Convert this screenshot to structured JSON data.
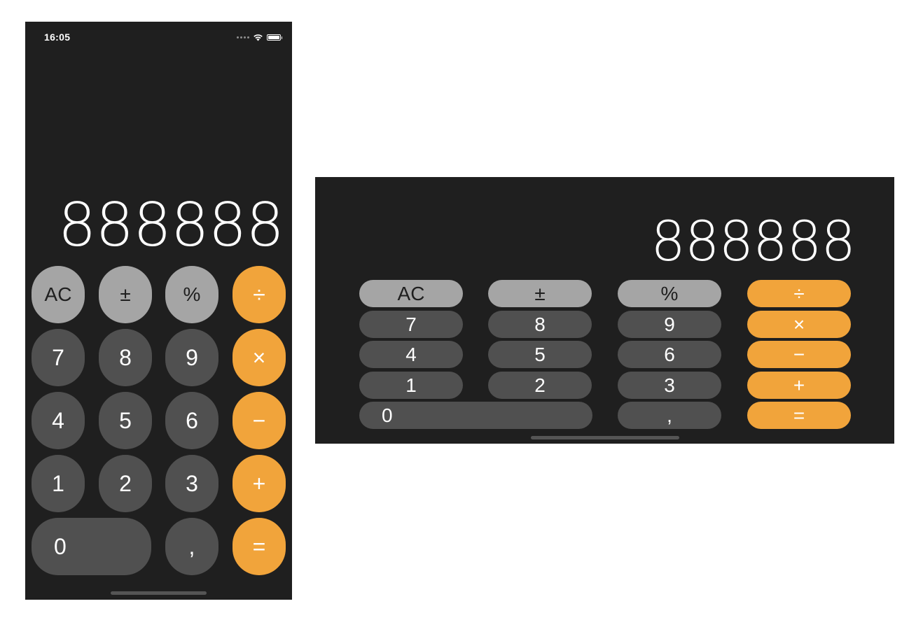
{
  "status_bar": {
    "time": "16:05"
  },
  "display": {
    "value": "888888"
  },
  "keys": {
    "clear": "AC",
    "sign": "±",
    "percent": "%",
    "divide": "÷",
    "multiply": "×",
    "minus": "−",
    "plus": "+",
    "equals": "=",
    "decimal": ",",
    "d0": "0",
    "d1": "1",
    "d2": "2",
    "d3": "3",
    "d4": "4",
    "d5": "5",
    "d6": "6",
    "d7": "7",
    "d8": "8",
    "d9": "9"
  },
  "colors": {
    "background": "#1f1f1f",
    "digit_key": "#505050",
    "function_key": "#a5a5a5",
    "operator_key": "#f1a43b",
    "page": "#ffffff"
  },
  "icons": [
    "cellular-signal-icon",
    "wifi-icon",
    "battery-icon"
  ]
}
